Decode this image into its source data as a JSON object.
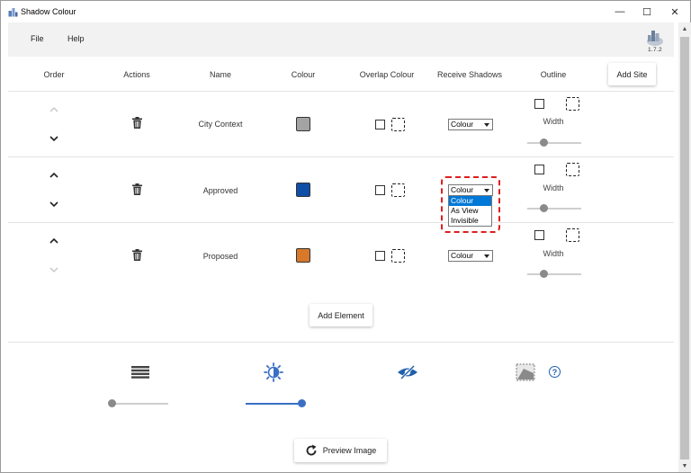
{
  "window": {
    "title": "Shadow Colour",
    "controls": {
      "minimize": "—",
      "maximize": "☐",
      "close": "✕"
    }
  },
  "menu": {
    "items": [
      "File",
      "Help"
    ],
    "version": "1.7.2"
  },
  "table": {
    "headers": {
      "order": "Order",
      "actions": "Actions",
      "name": "Name",
      "colour": "Colour",
      "overlap": "Overlap Colour",
      "receive": "Receive Shadows",
      "outline": "Outline"
    },
    "add_site_label": "Add Site",
    "rows": [
      {
        "name": "City Context",
        "colour": "#a3a3a3",
        "receive_shadows": "Colour",
        "width_label": "Width",
        "width_value": 0.35,
        "up_enabled": false,
        "down_enabled": true
      },
      {
        "name": "Approved",
        "colour": "#0f4fa8",
        "receive_shadows": "Colour",
        "width_label": "Width",
        "width_value": 0.35,
        "up_enabled": true,
        "down_enabled": true
      },
      {
        "name": "Proposed",
        "colour": "#d8782b",
        "receive_shadows": "Colour",
        "width_label": "Width",
        "width_value": 0.35,
        "up_enabled": true,
        "down_enabled": false
      }
    ],
    "add_element_label": "Add Element"
  },
  "dropdown_open": {
    "options": [
      "Colour",
      "As View",
      "Invisible"
    ],
    "selected": "Colour"
  },
  "bottom": {
    "icons": [
      "layers-icon",
      "brightness-icon",
      "hidden-eye-icon",
      "shadow-plane-icon",
      "help-icon"
    ],
    "slider_left_value": 0.0,
    "slider_right_value": 1.0,
    "help_glyph": "?",
    "preview_label": "Preview Image"
  },
  "colors": {
    "accent": "#0078d7",
    "slider_active": "#3a6fc4",
    "highlight": "#e01d1d",
    "eye": "#1f5fae"
  }
}
